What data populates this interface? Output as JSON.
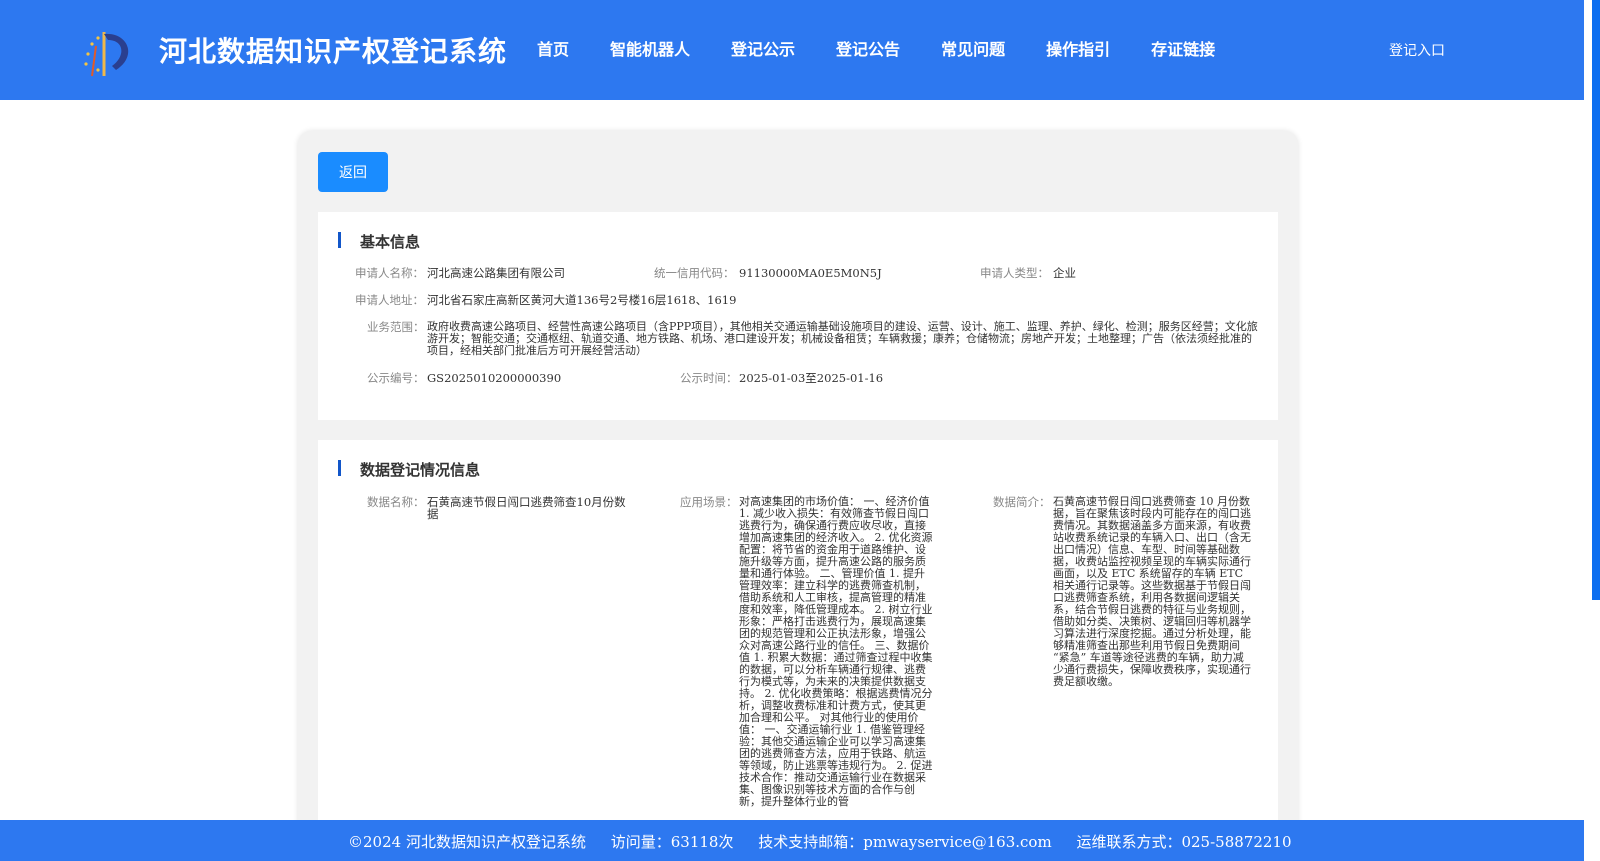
{
  "header": {
    "title": "河北数据知识产权登记系统",
    "nav": [
      "首页",
      "智能机器人",
      "登记公示",
      "登记公告",
      "常见问题",
      "操作指引",
      "存证链接"
    ],
    "login": "登记入口"
  },
  "back_label": "返回",
  "basic": {
    "title": "基本信息",
    "applicant_name_label": "申请人名称：",
    "applicant_name": "河北高速公路集团有限公司",
    "credit_code_label": "统一信用代码：",
    "credit_code": "91130000MA0E5M0N5J",
    "applicant_type_label": "申请人类型：",
    "applicant_type": "企业",
    "address_label": "申请人地址：",
    "address": "河北省石家庄高新区黄河大道136号2号楼16层1618、1619",
    "scope_label": "业务范围：",
    "scope": "政府收费高速公路项目、经营性高速公路项目（含PPP项目），其他相关交通运输基础设施项目的建设、运营、设计、施工、监理、养护、绿化、检测；服务区经营；文化旅游开发；智能交通；交通枢纽、轨道交通、地方铁路、机场、港口建设开发；机械设备租赁；车辆救援；康养；仓储物流；房地产开发；土地整理；广告（依法须经批准的项目，经相关部门批准后方可开展经营活动）",
    "notice_no_label": "公示编号：",
    "notice_no": "GS2025010200000390",
    "notice_time_label": "公示时间：",
    "notice_time": "2025-01-03至2025-01-16"
  },
  "data": {
    "title": "数据登记情况信息",
    "name_label": "数据名称：",
    "name": "石黄高速节假日闯口逃费筛查10月份数据",
    "scene_label": "应用场景：",
    "scene": "对高速集团的市场价值： 一、经济价值 1. 减少收入损失：有效筛查节假日闯口逃费行为，确保通行费应收尽收，直接增加高速集团的经济收入。 2. 优化资源配置：将节省的资金用于道路维护、设施升级等方面，提升高速公路的服务质量和通行体验。 二、管理价值 1. 提升管理效率：建立科学的逃费筛查机制，借助系统和人工审核，提高管理的精准度和效率，降低管理成本。 2. 树立行业形象：严格打击逃费行为，展现高速集团的规范管理和公正执法形象，增强公众对高速公路行业的信任。 三、数据价值 1. 积累大数据：通过筛查过程中收集的数据，可以分析车辆通行规律、逃费行为模式等，为未来的决策提供数据支持。 2. 优化收费策略：根据逃费情况分析，调整收费标准和计费方式，使其更加合理和公平。 对其他行业的使用价值： 一、交通运输行业 1. 借鉴管理经验：其他交通运输企业可以学习高速集团的逃费筛查方法，应用于铁路、航运等领域，防止逃票等违规行为。 2. 促进技术合作：推动交通运输行业在数据采集、图像识别等技术方面的合作与创新，提升整体行业的管",
    "intro_label": "数据简介：",
    "intro": "石黄高速节假日闯口逃费筛查 10 月份数据，旨在聚焦该时段内可能存在的闯口逃费情况。其数据涵盖多方面来源，有收费站收费系统记录的车辆入口、出口（含无出口情况）信息、车型、时间等基础数据，收费站监控视频呈现的车辆实际通行画面，以及 ETC 系统留存的车辆 ETC 相关通行记录等。这些数据基于节假日闯口逃费筛查系统，利用各数据间逻辑关系，结合节假日逃费的特征与业务规则，借助如分类、决策树、逻辑回归等机器学习算法进行深度挖掘。通过分析处理，能够精准筛查出那些利用节假日免费期间 “紧急” 车道等途径逃费的车辆，助力减少通行费损失，保障收费秩序，实现通行费足额收缴。"
  },
  "footer": {
    "copyright": "©2024 河北数据知识产权登记系统",
    "visits": "访问量：63118次",
    "email": "技术支持邮箱：pmwayservice@163.com",
    "phone": "运维联系方式：025-58872210"
  },
  "colors": {
    "primary": "#2d78f0",
    "button": "#1a8cff",
    "accent": "#1256c9"
  }
}
